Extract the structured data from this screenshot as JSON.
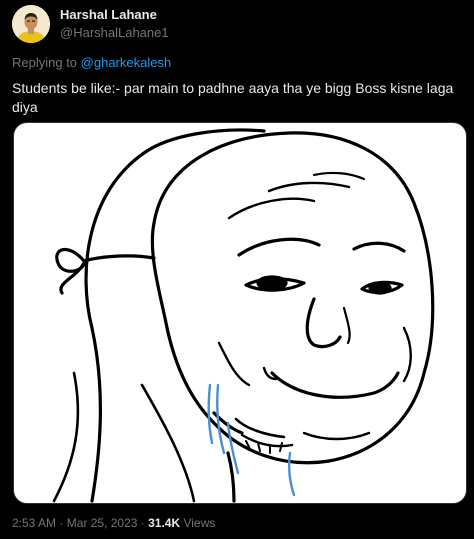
{
  "tweet": {
    "author": {
      "display_name": "Harshal Lahane",
      "handle": "@HarshalLahane1"
    },
    "reply": {
      "prefix": "Replying to ",
      "mention": "@gharkekalesh"
    },
    "text": "Students be like:- par main to padhne aaya tha ye bigg Boss kisne laga diya",
    "meta": {
      "time": "2:53 AM",
      "separator_1": " · ",
      "date": "Mar 25, 2023",
      "separator_2": " · ",
      "views_count": "31.4K",
      "views_label": " Views"
    }
  },
  "colors": {
    "background": "#000000",
    "primary_text": "#e7e9ea",
    "secondary_text": "#71767b",
    "mention": "#1d9bf0",
    "tear": "#4a8fd0"
  },
  "icons": {
    "avatar": "profile-photo",
    "media": "wojak-mask-meme-image"
  }
}
